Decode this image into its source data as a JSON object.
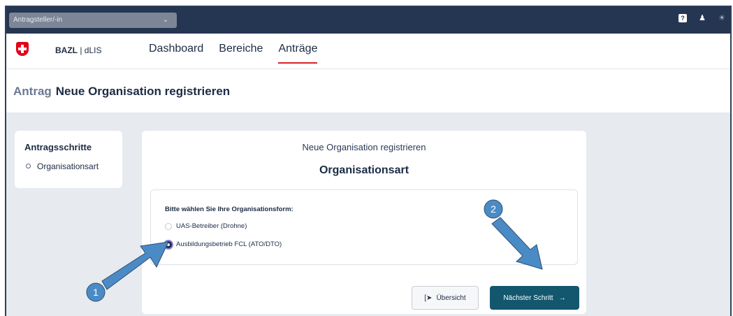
{
  "topbar": {
    "role_select_value": "Antragsteller/-in"
  },
  "header": {
    "brand_bold": "BAZL",
    "brand_rest": " | dLIS",
    "nav": [
      "Dashboard",
      "Bereiche",
      "Anträge"
    ]
  },
  "titlebar": {
    "prefix": "Antrag",
    "title": "Neue Organisation registrieren"
  },
  "steps": {
    "title": "Antragsschritte",
    "items": [
      "Organisationsart"
    ]
  },
  "main": {
    "subtitle": "Neue Organisation registrieren",
    "title": "Organisationsart",
    "question": "Bitte wählen Sie Ihre Organisationsform:",
    "options": [
      "UAS-Betreiber (Drohne)",
      "Ausbildungsbetrieb FCL (ATO/DTO)"
    ],
    "selected_option": "Ausbildungsbetrieb FCL (ATO/DTO)",
    "back_label": "Übersicht",
    "next_label": "Nächster Schritt"
  },
  "annotations": {
    "marker1": "1",
    "marker2": "2",
    "arrow_color": "#4a8bc6"
  },
  "icons": {
    "help": "help-icon",
    "user": "user-icon",
    "theme": "sun-icon",
    "back": "exit-icon",
    "next": "arrow-right-icon"
  }
}
